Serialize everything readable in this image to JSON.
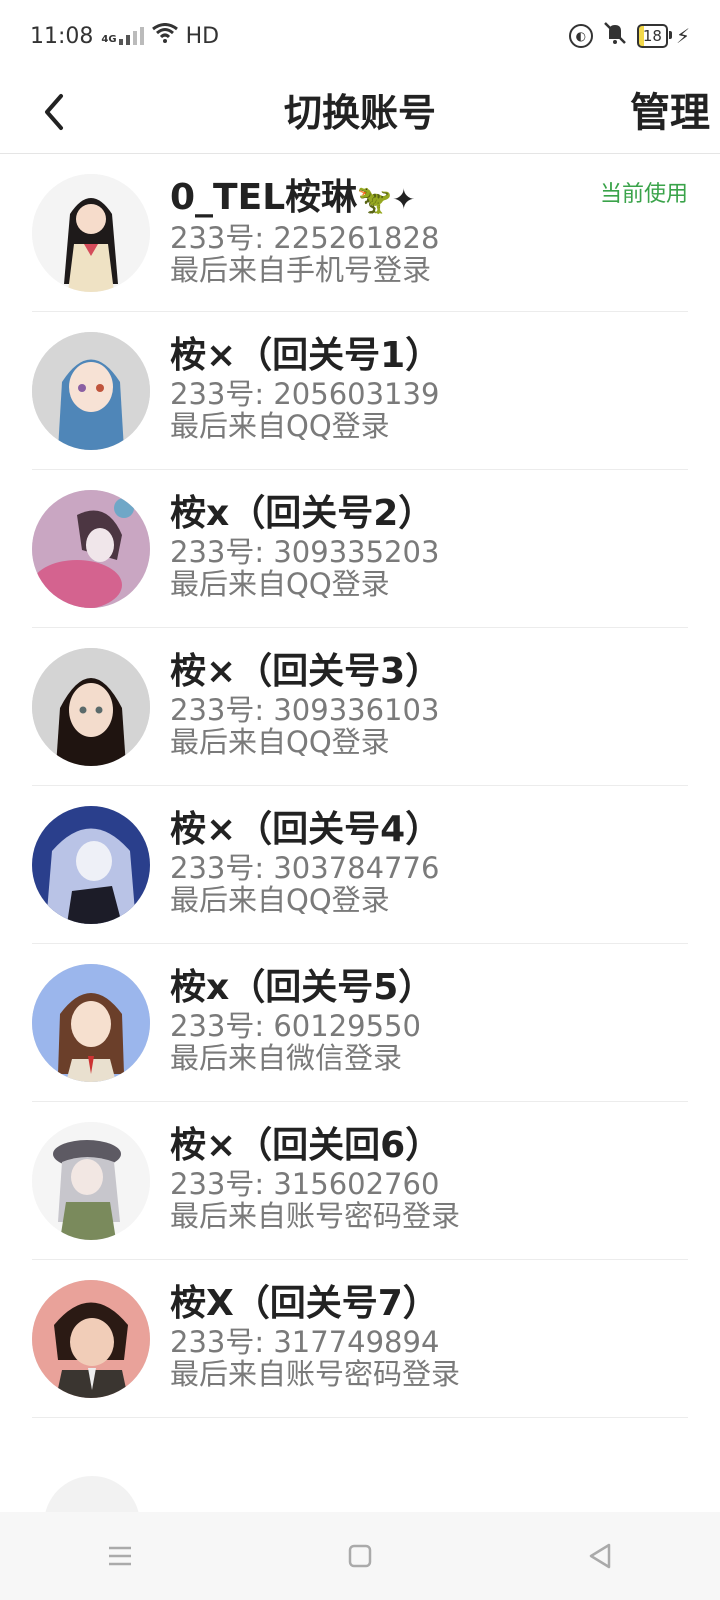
{
  "status_bar": {
    "time": "11:08",
    "network": "4G",
    "wifi_label": "HD",
    "battery": "18"
  },
  "header": {
    "title": "切换账号",
    "manage": "管理"
  },
  "accounts": [
    {
      "name": "0_TEL桉琳",
      "id": "233号: 225261828",
      "login": "最后来自手机号登录",
      "badge": "当前使用"
    },
    {
      "name": "桉×（回关号1）",
      "id": "233号: 205603139",
      "login": "最后来自QQ登录"
    },
    {
      "name": "桉x（回关号2）",
      "id": "233号: 309335203",
      "login": "最后来自QQ登录"
    },
    {
      "name": "桉×（回关号3）",
      "id": "233号: 309336103",
      "login": "最后来自QQ登录"
    },
    {
      "name": "桉×（回关号4）",
      "id": "233号: 303784776",
      "login": "最后来自QQ登录"
    },
    {
      "name": "桉x（回关号5）",
      "id": "233号: 60129550",
      "login": "最后来自微信登录"
    },
    {
      "name": "桉×（回关回6）",
      "id": "233号: 315602760",
      "login": "最后来自账号密码登录"
    },
    {
      "name": "桉X（回关号7）",
      "id": "233号: 317749894",
      "login": "最后来自账号密码登录"
    }
  ],
  "icons": {
    "back": "chevron-left-icon",
    "nav_menu": "menu-icon",
    "nav_home": "square-icon",
    "nav_back": "triangle-back-icon"
  },
  "colors": {
    "current_badge": "#3aa34a",
    "secondary_text": "#7a7a7a"
  }
}
